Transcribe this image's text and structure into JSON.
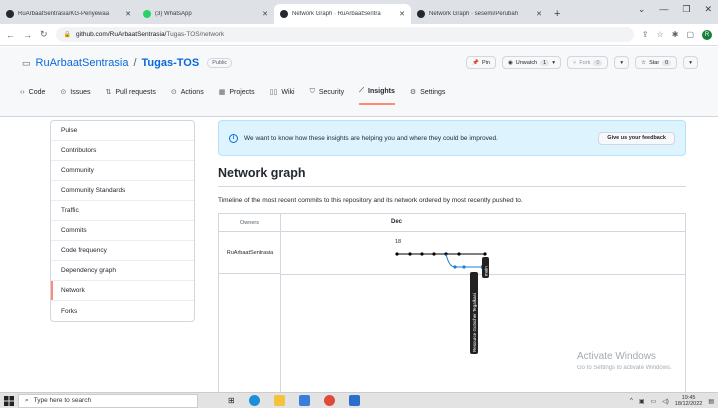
{
  "browser": {
    "tabs": [
      {
        "title": "RuArbaatSentrasia/KG-Penyewaa",
        "icon": "github-icon",
        "active": false
      },
      {
        "title": "(3) WhatsApp",
        "icon": "whatsapp-icon",
        "active": false
      },
      {
        "title": "Network Graph · RuArbaatSentra",
        "icon": "github-icon",
        "active": true
      },
      {
        "title": "Network Graph · sesemi/Perubah",
        "icon": "github-icon",
        "active": false
      }
    ],
    "new_tab": "+",
    "address": {
      "host": "github.com/RuArbaatSentrasia/",
      "path": "Tugas-TOS/network"
    },
    "profile_initial": "R"
  },
  "repo": {
    "owner": "RuArbaatSentrasia",
    "separator": "/",
    "name": "Tugas-TOS",
    "visibility": "Public",
    "actions": {
      "pin": "Pin",
      "unwatch": "Unwatch",
      "unwatch_count": "1",
      "fork": "Fork",
      "fork_count": "0",
      "star": "Star",
      "star_count": "0"
    },
    "tabs": [
      {
        "label": "Code",
        "icon": "code-icon"
      },
      {
        "label": "Issues",
        "icon": "issue-icon"
      },
      {
        "label": "Pull requests",
        "icon": "pull-request-icon"
      },
      {
        "label": "Actions",
        "icon": "play-icon"
      },
      {
        "label": "Projects",
        "icon": "table-icon"
      },
      {
        "label": "Wiki",
        "icon": "book-icon"
      },
      {
        "label": "Security",
        "icon": "shield-icon"
      },
      {
        "label": "Insights",
        "icon": "graph-icon",
        "selected": true
      },
      {
        "label": "Settings",
        "icon": "gear-icon"
      }
    ]
  },
  "sidebar": {
    "items": [
      {
        "label": "Pulse"
      },
      {
        "label": "Contributors"
      },
      {
        "label": "Community"
      },
      {
        "label": "Community Standards"
      },
      {
        "label": "Traffic"
      },
      {
        "label": "Commits"
      },
      {
        "label": "Code frequency"
      },
      {
        "label": "Dependency graph"
      },
      {
        "label": "Network",
        "selected": true
      },
      {
        "label": "Forks"
      }
    ]
  },
  "flash": {
    "message": "We want to know how these insights are helping you and where they could be improved.",
    "button": "Give us your feedback"
  },
  "network": {
    "title": "Network graph",
    "description": "Timeline of the most recent commits to this repository and its network ordered by most recently pushed to.",
    "owners_header": "Owners",
    "month": "Dec",
    "day": "18",
    "owner_row": "RuArbaatSentrasia",
    "branch_main": "main",
    "branch_feature": "Resource Gutscher Tegalkasi",
    "colors": {
      "main": "#000000",
      "feature": "#1a7fd4"
    }
  },
  "watermark": {
    "title": "Activate Windows",
    "subtitle": "Go to Settings to activate Windows."
  },
  "taskbar": {
    "search_placeholder": "Type here to search",
    "time": "19:45",
    "date": "18/12/2022"
  }
}
